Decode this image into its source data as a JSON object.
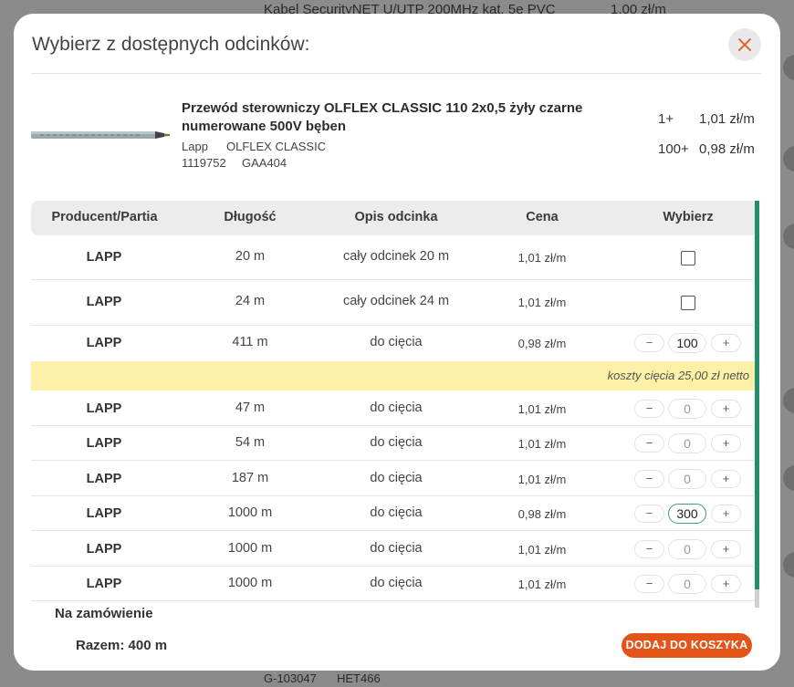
{
  "background": {
    "top_left_text": "Kabel SecurityNET U/UTP 200MHz kat. 5e PVC",
    "top_right_text": "1,00 zł/m",
    "bottom_code_1": "G-103047",
    "bottom_code_2": "HET466"
  },
  "modal": {
    "title": "Wybierz z dostępnych odcinków:",
    "close_icon": "close-icon",
    "accent_color": "#e3541a"
  },
  "product": {
    "name": "Przewód sterowniczy OLFLEX CLASSIC 110 2x0,5 żyły czarne numerowane 500V bęben",
    "manufacturer": "Lapp",
    "series": "OLFLEX CLASSIC",
    "code": "1119752",
    "symbol": "GAA404",
    "price_tiers": [
      {
        "qty": "1+",
        "price": "1,01 zł/m"
      },
      {
        "qty": "100+",
        "price": "0,98 zł/m"
      }
    ]
  },
  "table": {
    "headers": {
      "producer": "Producent/Partia",
      "length": "Długość",
      "description": "Opis odcinka",
      "price": "Cena",
      "select": "Wybierz"
    },
    "rows": [
      {
        "producer": "LAPP",
        "length": "20 m",
        "description": "cały odcinek 20 m",
        "price": "1,01 zł/m",
        "control": "checkbox"
      },
      {
        "producer": "LAPP",
        "length": "24 m",
        "description": "cały odcinek 24 m",
        "price": "1,01 zł/m",
        "control": "checkbox"
      },
      {
        "producer": "LAPP",
        "length": "411 m",
        "description": "do cięcia",
        "price": "0,98 zł/m",
        "control": "stepper",
        "value": "100"
      },
      {
        "producer": "LAPP",
        "length": "47 m",
        "description": "do cięcia",
        "price": "1,01 zł/m",
        "control": "stepper",
        "value": "0"
      },
      {
        "producer": "LAPP",
        "length": "54 m",
        "description": "do cięcia",
        "price": "1,01 zł/m",
        "control": "stepper",
        "value": "0"
      },
      {
        "producer": "LAPP",
        "length": "187 m",
        "description": "do cięcia",
        "price": "1,01 zł/m",
        "control": "stepper",
        "value": "0"
      },
      {
        "producer": "LAPP",
        "length": "1000 m",
        "description": "do cięcia",
        "price": "0,98 zł/m",
        "control": "stepper",
        "value": "300"
      },
      {
        "producer": "LAPP",
        "length": "1000 m",
        "description": "do cięcia",
        "price": "1,01 zł/m",
        "control": "stepper",
        "value": "0"
      },
      {
        "producer": "LAPP",
        "length": "1000 m",
        "description": "do cięcia",
        "price": "1,01 zł/m",
        "control": "stepper",
        "value": "0"
      }
    ],
    "cut_cost_note": "koszty cięcia 25,00 zł netto",
    "stepper_minus": "−",
    "stepper_plus": "+"
  },
  "footer": {
    "on_order_label": "Na zamówienie",
    "total_label": "Razem: 400 m",
    "add_to_cart_label": "DODAJ DO KOSZYKA"
  }
}
